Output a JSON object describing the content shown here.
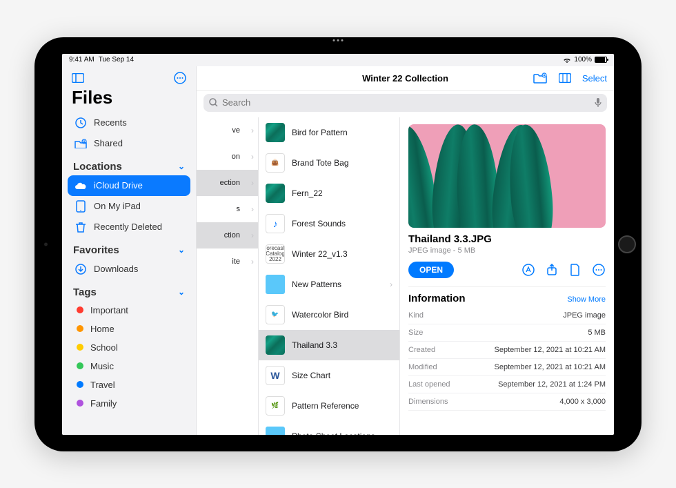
{
  "status": {
    "time": "9:41 AM",
    "date": "Tue Sep 14",
    "battery": "100%"
  },
  "sidebar": {
    "title": "Files",
    "primary": [
      {
        "icon": "clock",
        "label": "Recents"
      },
      {
        "icon": "shared",
        "label": "Shared"
      }
    ],
    "sections": [
      {
        "title": "Locations",
        "items": [
          {
            "icon": "icloud",
            "label": "iCloud Drive",
            "selected": true
          },
          {
            "icon": "ipad",
            "label": "On My iPad"
          },
          {
            "icon": "trash",
            "label": "Recently Deleted"
          }
        ]
      },
      {
        "title": "Favorites",
        "items": [
          {
            "icon": "download",
            "label": "Downloads"
          }
        ]
      },
      {
        "title": "Tags",
        "items": [
          {
            "color": "#ff3b30",
            "label": "Important"
          },
          {
            "color": "#ff9500",
            "label": "Home"
          },
          {
            "color": "#ffcc00",
            "label": "School"
          },
          {
            "color": "#34c759",
            "label": "Music"
          },
          {
            "color": "#007aff",
            "label": "Travel"
          },
          {
            "color": "#af52de",
            "label": "Family"
          }
        ]
      }
    ]
  },
  "header": {
    "title": "Winter 22 Collection",
    "select": "Select",
    "search_placeholder": "Search"
  },
  "colA": [
    {
      "label": "ve"
    },
    {
      "label": "on"
    },
    {
      "label": "ection",
      "sel": true
    },
    {
      "label": "s"
    },
    {
      "label": "ction",
      "sel": true
    },
    {
      "label": "ite"
    }
  ],
  "colB": [
    {
      "thumb": "leaves",
      "label": "Bird for Pattern"
    },
    {
      "thumb": "bag",
      "label": "Brand Tote Bag"
    },
    {
      "thumb": "leaves",
      "label": "Fern_22"
    },
    {
      "thumb": "audio",
      "label": "Forest Sounds"
    },
    {
      "thumb": "doc",
      "label": "Winter 22_v1.3"
    },
    {
      "thumb": "folder",
      "label": "New Patterns",
      "chev": true
    },
    {
      "thumb": "bird",
      "label": "Watercolor Bird"
    },
    {
      "thumb": "leaves",
      "label": "Thailand 3.3",
      "sel": true
    },
    {
      "thumb": "word",
      "label": "Size Chart"
    },
    {
      "thumb": "plant",
      "label": "Pattern Reference"
    },
    {
      "thumb": "folder",
      "label": "Photo Shoot Locations",
      "chev": true
    }
  ],
  "detail": {
    "filename": "Thailand 3.3.JPG",
    "meta": "JPEG image - 5 MB",
    "open": "OPEN",
    "info_title": "Information",
    "show_more": "Show More",
    "rows": [
      {
        "k": "Kind",
        "v": "JPEG image"
      },
      {
        "k": "Size",
        "v": "5 MB"
      },
      {
        "k": "Created",
        "v": "September 12, 2021 at 10:21 AM"
      },
      {
        "k": "Modified",
        "v": "September 12, 2021 at 10:21 AM"
      },
      {
        "k": "Last opened",
        "v": "September 12, 2021 at 1:24 PM"
      },
      {
        "k": "Dimensions",
        "v": "4,000 x 3,000"
      }
    ]
  }
}
